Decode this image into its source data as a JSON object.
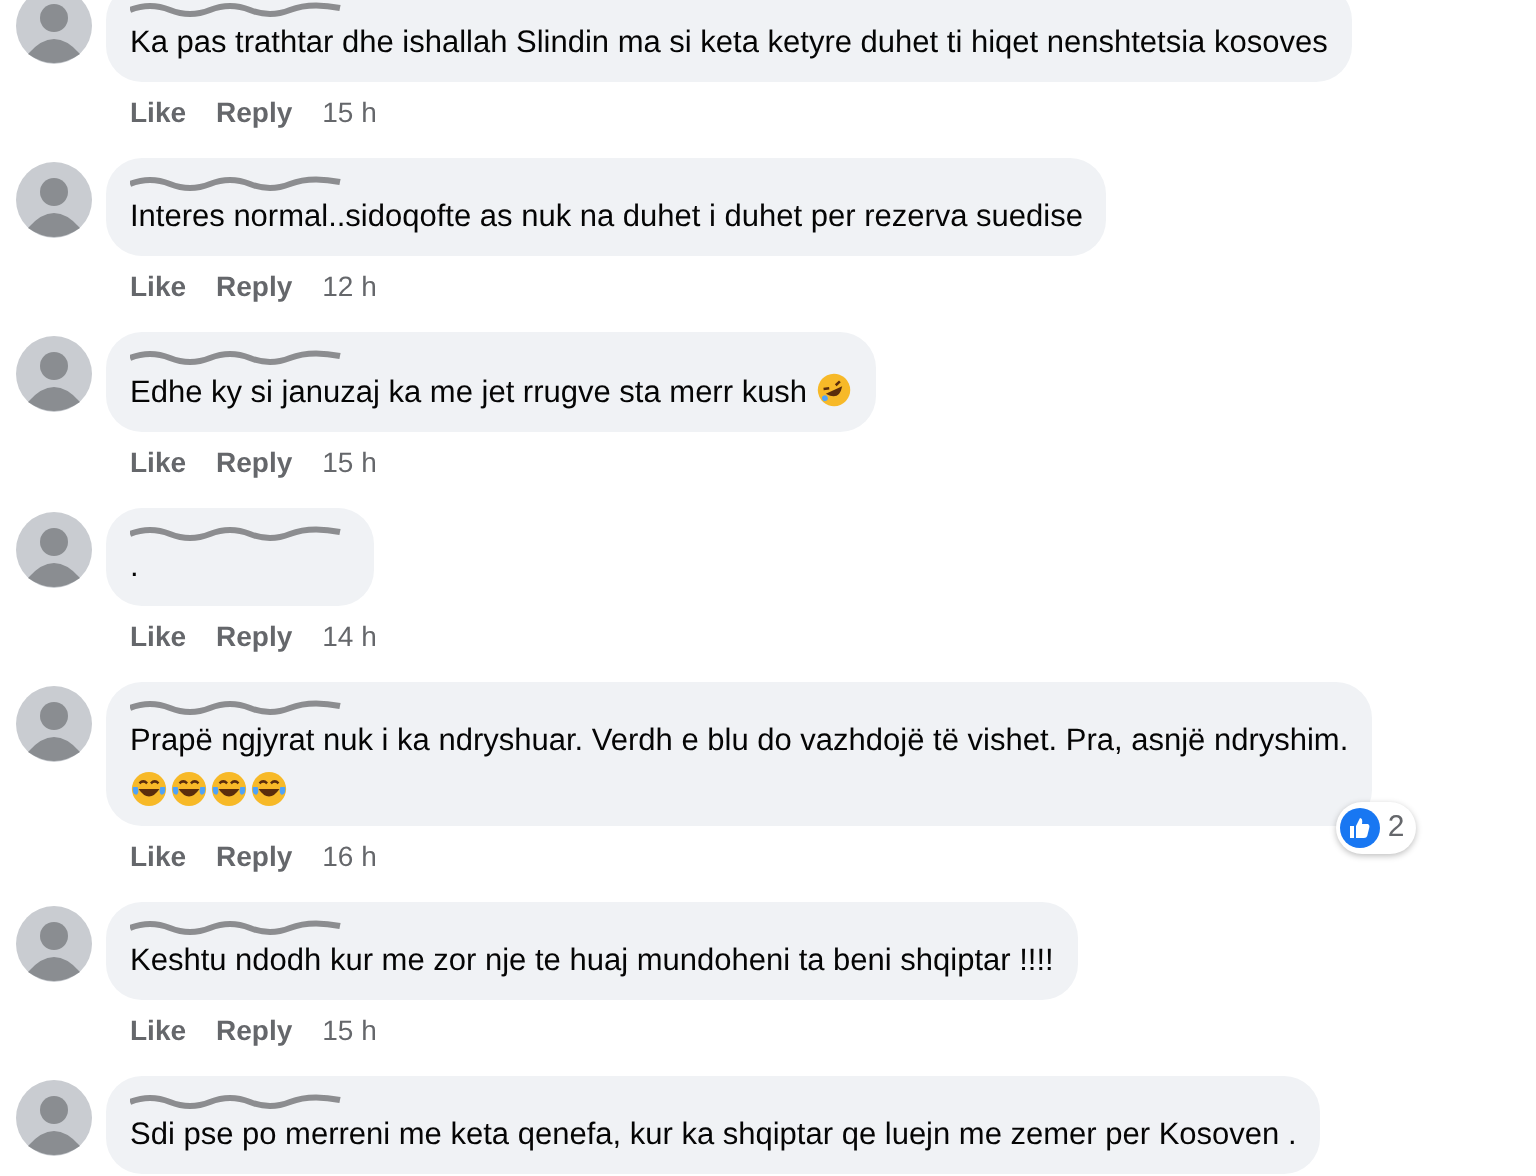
{
  "comments": [
    {
      "text": "Ka pas trathtar dhe ishallah Slindin ma si keta ketyre duhet ti hiqet nenshtetsia kosoves",
      "actions": [
        "Like",
        "Reply"
      ],
      "time": "15 h"
    },
    {
      "text": "Interes normal..sidoqofte as nuk na duhet i duhet per rezerva suedise",
      "actions": [
        "Like",
        "Reply"
      ],
      "time": "12 h"
    },
    {
      "text": "Edhe ky si januzaj ka me jet rrugve sta merr kush",
      "emojis": [
        {
          "kind": "rolling"
        }
      ],
      "actions": [
        "Like",
        "Reply"
      ],
      "time": "15 h"
    },
    {
      "text": ".",
      "actions": [
        "Like",
        "Reply"
      ],
      "time": "14 h"
    },
    {
      "text": "Prapë ngjyrat nuk i ka ndryshuar. Verdh e blu do vazhdojë të vishet. Pra, asnjë ndryshim.",
      "emojis": [
        {
          "kind": "tears"
        },
        {
          "kind": "tears"
        },
        {
          "kind": "tears"
        },
        {
          "kind": "tears"
        }
      ],
      "actions": [
        "Like",
        "Reply"
      ],
      "time": "16 h",
      "reactions": {
        "count": "2"
      }
    },
    {
      "text": "Keshtu ndodh kur me zor nje te huaj mundoheni ta beni shqiptar !!!!",
      "actions": [
        "Like",
        "Reply"
      ],
      "time": "15 h"
    },
    {
      "text": "Sdi pse po merreni me keta qenefa, kur ka shqiptar qe luejn me zemer per Kosoven ."
    }
  ]
}
